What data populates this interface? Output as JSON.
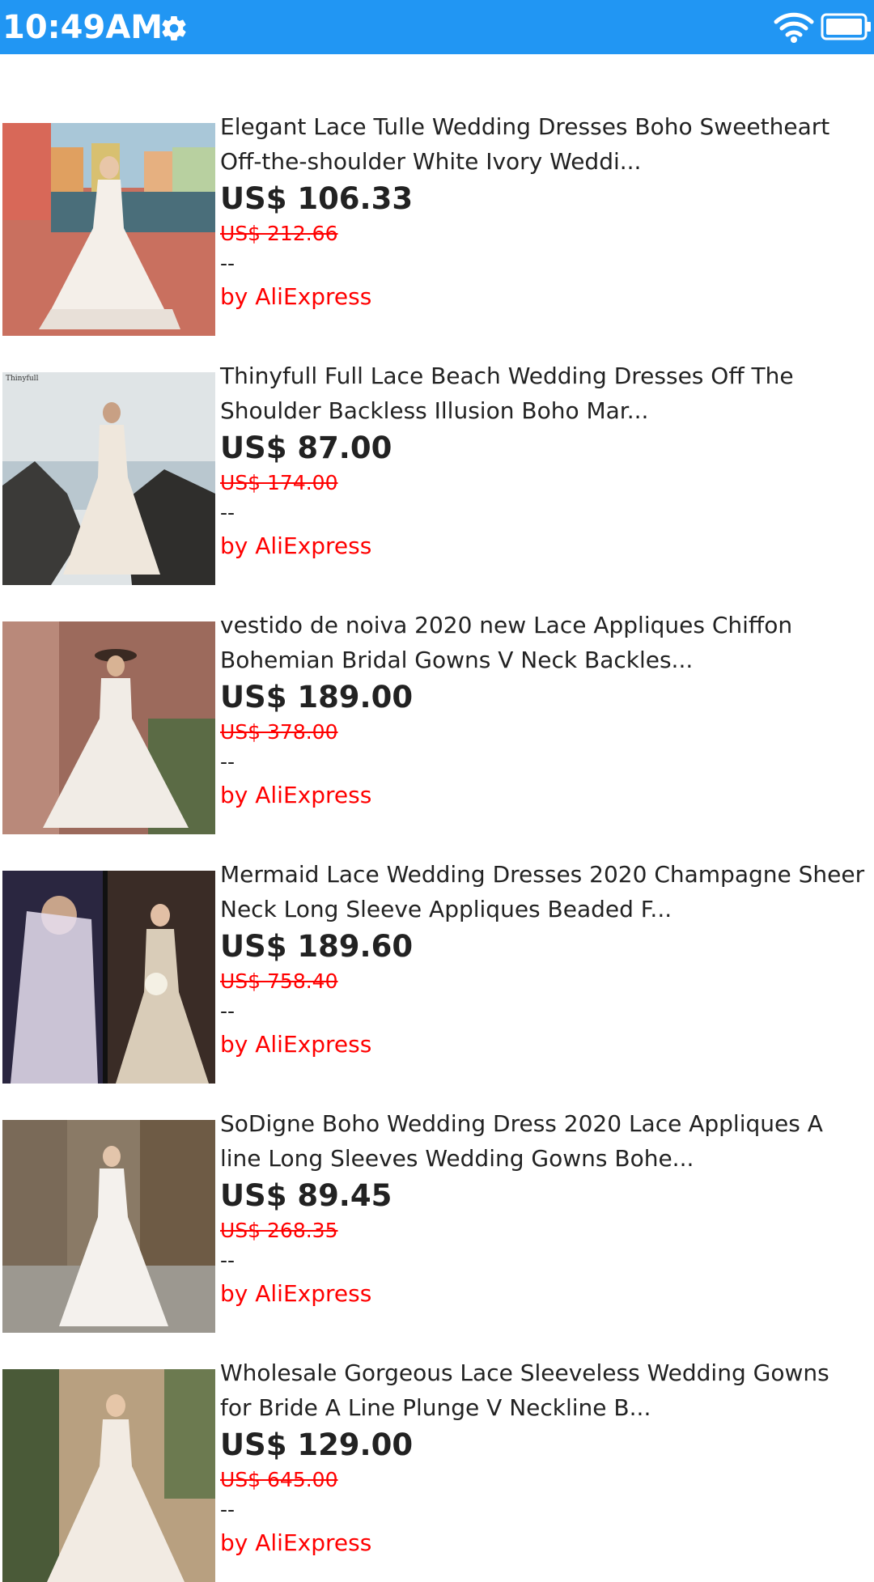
{
  "status_bar": {
    "time": "10:49AM",
    "color": "#2196f3",
    "icons": [
      "gear-icon",
      "wifi-icon",
      "battery-icon"
    ]
  },
  "products": [
    {
      "title": "Elegant Lace Tulle Wedding Dresses Boho Sweetheart Off-the-shoulder White Ivory Weddi...",
      "price": "US$ 106.33",
      "original_price": "US$ 212.66",
      "rating": "--",
      "seller": "by AliExpress"
    },
    {
      "title": "Thinyfull Full Lace Beach Wedding Dresses Off The Shoulder Backless Illusion Boho Mar...",
      "price": "US$ 87.00",
      "original_price": "US$ 174.00",
      "rating": "--",
      "seller": "by AliExpress",
      "image_label": "Thinyfull"
    },
    {
      "title": "vestido de noiva 2020 new Lace Appliques Chiffon Bohemian Bridal Gowns V Neck Backles...",
      "price": "US$ 189.00",
      "original_price": "US$ 378.00",
      "rating": "--",
      "seller": "by AliExpress"
    },
    {
      "title": "Mermaid Lace Wedding Dresses 2020 Champagne Sheer Neck Long Sleeve Appliques Beaded F...",
      "price": "US$ 189.60",
      "original_price": "US$ 758.40",
      "rating": "--",
      "seller": "by AliExpress"
    },
    {
      "title": "SoDigne Boho Wedding Dress 2020 Lace Appliques A line Long Sleeves Wedding Gowns Bohe...",
      "price": "US$ 89.45",
      "original_price": "US$ 268.35",
      "rating": "--",
      "seller": "by AliExpress"
    },
    {
      "title": "Wholesale Gorgeous Lace Sleeveless Wedding Gowns for Bride A Line Plunge V Neckline B...",
      "price": "US$ 129.00",
      "original_price": "US$ 645.00",
      "rating": "--",
      "seller": "by AliExpress"
    }
  ]
}
